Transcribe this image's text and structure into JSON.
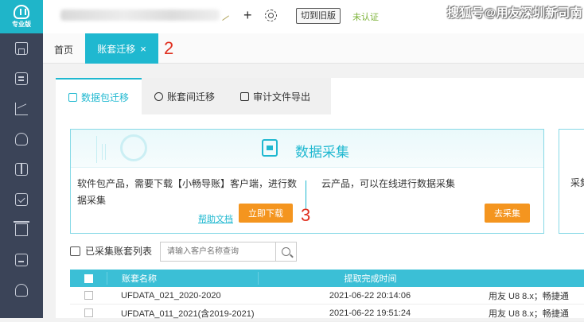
{
  "sidebar": {
    "logo_text": "专业版",
    "icons": [
      "home-icon",
      "document-icon",
      "chart-icon",
      "bag-icon",
      "book-icon",
      "check-icon",
      "cart-icon",
      "screen-icon",
      "hand-icon"
    ]
  },
  "header": {
    "switch_old_label": "切到旧版",
    "uncertified_label": "未认证",
    "watermark": "搜狐号@用友深圳新司南"
  },
  "tabs": {
    "home_label": "首页",
    "active_label": "账套迁移",
    "close_glyph": "×"
  },
  "annotations": {
    "a2": "2",
    "a3": "3"
  },
  "subtabs": [
    {
      "label": "数据包迁移"
    },
    {
      "label": "账套间迁移"
    },
    {
      "label": "审计文件导出"
    }
  ],
  "collect_card": {
    "title": "数据采集",
    "left_text": "软件包产品，需要下载【小畅导账】客户端，进行数据采集",
    "help_link": "帮助文档",
    "download_btn": "立即下载",
    "right_text": "云产品，可以在线进行数据采集",
    "collect_btn": "去采集",
    "next_card_text": "采集"
  },
  "list": {
    "title": "已采集账套列表",
    "search_placeholder": "请输入客户名称查询"
  },
  "table": {
    "headers": [
      "账套名称",
      "提取完成时间",
      ""
    ],
    "rows": [
      [
        "UFDATA_021_2020-2020",
        "2021-06-22 20:14:06",
        "用友 U8 8.x；畅捷通"
      ],
      [
        "UFDATA_011_2021(含2019-2021)",
        "2021-06-22 19:51:24",
        "用友 U8 8.x；畅捷通"
      ]
    ]
  }
}
